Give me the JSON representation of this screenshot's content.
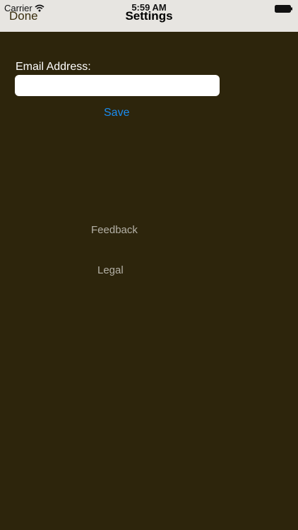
{
  "status_bar": {
    "carrier": "Carrier",
    "time": "5:59 AM",
    "wifi_icon": "wifi-icon",
    "battery_icon": "battery-icon"
  },
  "nav": {
    "done_label": "Done",
    "title": "Settings"
  },
  "form": {
    "email_label": "Email Address:",
    "email_value": "",
    "email_placeholder": "",
    "save_label": "Save"
  },
  "links": {
    "feedback_label": "Feedback",
    "legal_label": "Legal"
  },
  "colors": {
    "background": "#2d250c",
    "nav_bar": "#e7e5e1",
    "accent": "#1a8cf0",
    "link_text": "#b3b0a6"
  }
}
